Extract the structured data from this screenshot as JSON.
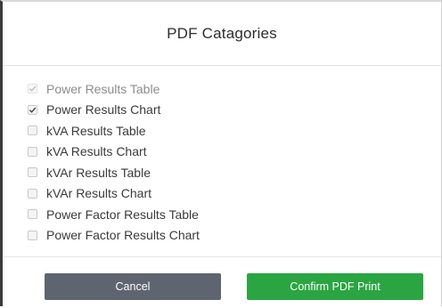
{
  "dialog": {
    "title": "PDF Catagories",
    "options": [
      {
        "label": "Power Results Table",
        "checked": true,
        "disabled": true
      },
      {
        "label": "Power Results Chart",
        "checked": true,
        "disabled": false
      },
      {
        "label": "kVA Results Table",
        "checked": false,
        "disabled": false
      },
      {
        "label": "kVA Results Chart",
        "checked": false,
        "disabled": false
      },
      {
        "label": "kVAr Results Table",
        "checked": false,
        "disabled": false
      },
      {
        "label": "kVAr Results Chart",
        "checked": false,
        "disabled": false
      },
      {
        "label": "Power Factor Results Table",
        "checked": false,
        "disabled": false
      },
      {
        "label": "Power Factor Results Chart",
        "checked": false,
        "disabled": false
      }
    ],
    "cancel_label": "Cancel",
    "confirm_label": "Confirm PDF Print"
  },
  "colors": {
    "cancel_button": "#5f6570",
    "confirm_button": "#2aa542"
  }
}
